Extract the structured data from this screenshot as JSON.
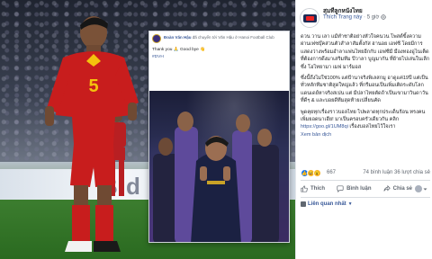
{
  "photo": {
    "board_text": "Bid",
    "jersey_number": "5",
    "colors": {
      "jersey": "#c81d1d",
      "pitch": "#2d6a25",
      "board": "#e9eef4"
    }
  },
  "embedded_post": {
    "author": "Đoàn Văn Hậu",
    "header_rest": "đã chuyển tới Văn Hậu ở Hanoi Football Club",
    "time": "",
    "message": "Thank you 🙏 Good bye 👋",
    "hashtag": "#DVH"
  },
  "post": {
    "page_name": "สุมทีลูกหนังไทย",
    "page_meta_follow": "Thích Trang này",
    "page_meta_time": "5 giờ",
    "paragraphs": [
      "ดวน วาน เลา แม้ทำชาติอย่างหัวใจคนวน โพสต์ขิ้งความผ่านเฟซบุ๊คส่วนตัวสำลาสัมตั้งกัส ฮานอย เอฟซี โดยมีการแสดงว่างพร้อมอำลาแฟนไทยอีกกับ เอฟซีมี มืองทองอูไนเต็ด ที่ต้องการดึงมาเสริมทีม ปีวาลา บูญมากัน ที่ย้ายไปเล่นในเลีกซึ่ง โอไทยามา เมฟ มาร์มอส",
      "ซึ่งนี้ถึงไม่ใช่100% แต่ป้านาจริงพิเลสกมู อาดูแค่19ปี แต่เป็นทั่วหลักทีมชาติสูดใหญ่แล้ว ที่กรีมอนเป็นเพิ่มเติดระดับโลก แดนเดย์หาจริงสเปน แต่ มีปลาไทยตัดถ้าเป็นเขามาวินดาวันที่ดีๆ & และบอยดีทีมสุดท้ายเปลี่ยนคัด",
      "พูดคุยทุกเรื่องราวบอลไทย ไปพลาดทุกประเด็นร้อน ทรงคนเพิ่มยอดนาเฮีย! มาเป็นครอบครัวเดียวกัน คลิก"
    ],
    "link": "https://goo.gl/1UM8qi",
    "link_suffix": " เรื่องบอลไทยไว้ใจเรา",
    "see_translation": "Xem bản dịch",
    "reaction_count": "667",
    "stats": "74 bình luận   36 lượt chia sẻ",
    "actions": [
      {
        "label": "Thích",
        "icon": "thumbs-up-icon"
      },
      {
        "label": "Bình luận",
        "icon": "comment-icon"
      },
      {
        "label": "Chia sẻ",
        "icon": "share-icon"
      }
    ],
    "related": "Liên quan nhất",
    "colors": {
      "link": "#385898",
      "text": "#1c1e21",
      "muted": "#606770",
      "like": "#1877f2"
    }
  }
}
